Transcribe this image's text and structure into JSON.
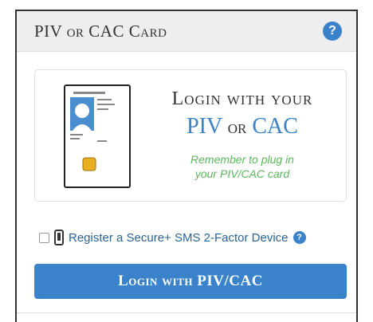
{
  "header": {
    "title": "PIV or CAC Card",
    "help_icon": "?"
  },
  "card": {
    "line1": "Login with your",
    "piv": "PIV",
    "or": "or",
    "cac": "CAC",
    "reminder_line1": "Remember to plug in",
    "reminder_line2": "your PIV/CAC card",
    "illustration": "id-card-icon"
  },
  "sms": {
    "label": "Register a Secure+ SMS 2-Factor Device",
    "checked": false,
    "help_icon": "?"
  },
  "login_button": {
    "label": "Login with PIV/CAC"
  },
  "colors": {
    "accent": "#3a82c9",
    "reminder": "#5cb85c",
    "header_bg": "#eeeeee"
  }
}
